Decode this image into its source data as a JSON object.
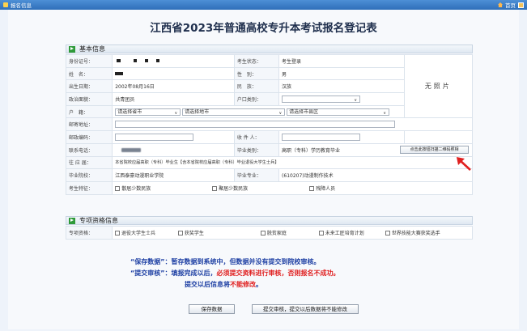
{
  "topbar": {
    "title": "报名信息",
    "home": "首页"
  },
  "page_title": "江西省2023年普通高校专升本考试报名登记表",
  "basic": {
    "section": "基本信息",
    "id_label": "身份证号：",
    "exam_status_label": "考生状态：",
    "exam_status": "考生登录",
    "name_label": "姓　名：",
    "gender_label": "性　别：",
    "gender": "男",
    "birth_label": "出生日期：",
    "birth": "2002年08月16日",
    "ethnic_label": "民　族：",
    "ethnic": "汉族",
    "political_label": "政治面貌：",
    "political": "共青团员",
    "hukou_label": "户口类别：",
    "hukou_value": "",
    "no_photo": "无照片",
    "huji_label": "户　籍：",
    "province_placeholder": "请选择省市",
    "city_placeholder": "请选择地市",
    "county_placeholder": "请选择市县区",
    "address_label": "邮寄地址：",
    "postcode_label": "邮政编码：",
    "recipient_label": "收 件 人：",
    "phone_label": "联系电话：",
    "grad_type_label": "毕业类别：",
    "grad_type": "高职（专科）学历教育毕业",
    "qr_button": "点击此按钮扫描二维码照相",
    "resume_label": "往 应 届：",
    "resume": "本省院校应届高职（专科）毕业生【含本省院校应届高职（专科）毕业退役大学生士兵】",
    "school_label": "毕业院校：",
    "school": "江西泰豪动漫职业学院",
    "major_label": "毕业专业：",
    "major": "(610207)动漫制作技术",
    "feature_label": "考生特征：",
    "features": [
      "散居少数民族",
      "聚居少数民族",
      "残障人员"
    ]
  },
  "special": {
    "section": "专项资格信息",
    "label": "专项资格：",
    "options": [
      "退役大学生士兵",
      "获奖学生",
      "脱贫家庭",
      "未来工匠培育计划",
      "世界技能大赛获奖选手"
    ]
  },
  "notes": {
    "save_head": "“保存数据”：",
    "save_text": "暂存数据到系统中，但数据并没有提交到院校审核。",
    "submit_head": "“提交审核”：",
    "submit_text1": "填报完成以后，",
    "submit_text2": "必须提交资料进行审核，否则报名不成功。",
    "after_text1": "提交以后信息将",
    "after_text2": "不能修改",
    "after_text3": "。"
  },
  "buttons": {
    "save": "保存数据",
    "submit": "提交审核，提交以后数据将不能修改"
  }
}
